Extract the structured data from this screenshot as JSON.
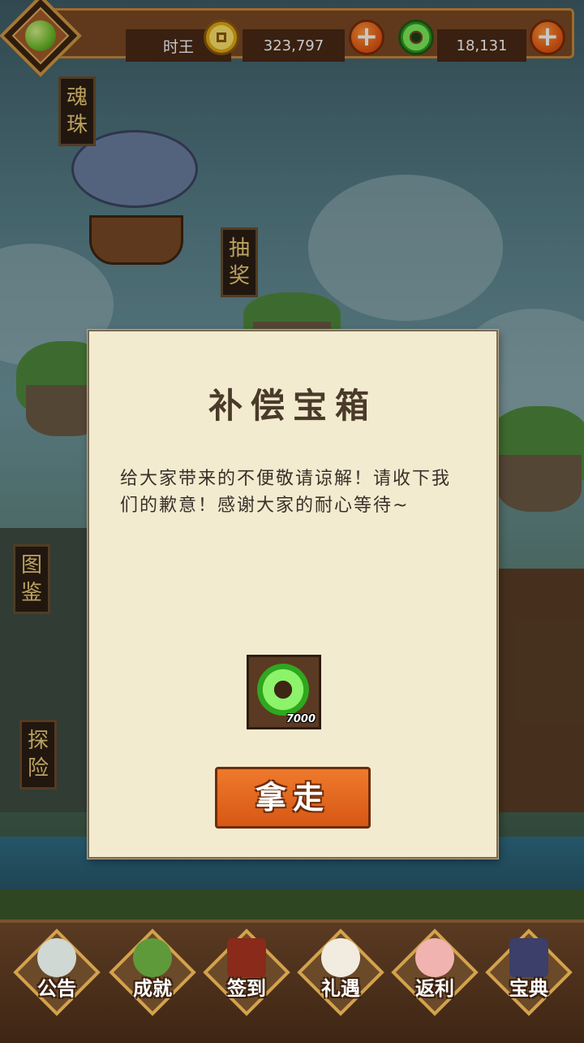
{
  "top_bar": {
    "player_name": "时王",
    "coins": "323,797",
    "jade": "18,131"
  },
  "side_signs": [
    {
      "label": "魂珠"
    },
    {
      "label": "抽奖"
    },
    {
      "label": "图鉴"
    },
    {
      "label": "探险"
    }
  ],
  "dialog": {
    "title": "补偿宝箱",
    "message": "给大家带来的不便敬请谅解！请收下我们的歉意！感谢大家的耐心等待~",
    "reward_count": "7000",
    "take_button": "拿走"
  },
  "bottom_nav": [
    {
      "label": "公告",
      "icon": "notice-icon"
    },
    {
      "label": "成就",
      "icon": "achievement-icon"
    },
    {
      "label": "签到",
      "icon": "checkin-icon"
    },
    {
      "label": "礼遇",
      "icon": "gift-icon"
    },
    {
      "label": "返利",
      "icon": "rebate-icon"
    },
    {
      "label": "宝典",
      "icon": "book-icon"
    }
  ],
  "colors": {
    "button_orange": "#e06a1f",
    "dialog_paper": "#f3ebd0",
    "wood_dark": "#4a2a16",
    "gold_border": "#d4a24c"
  }
}
